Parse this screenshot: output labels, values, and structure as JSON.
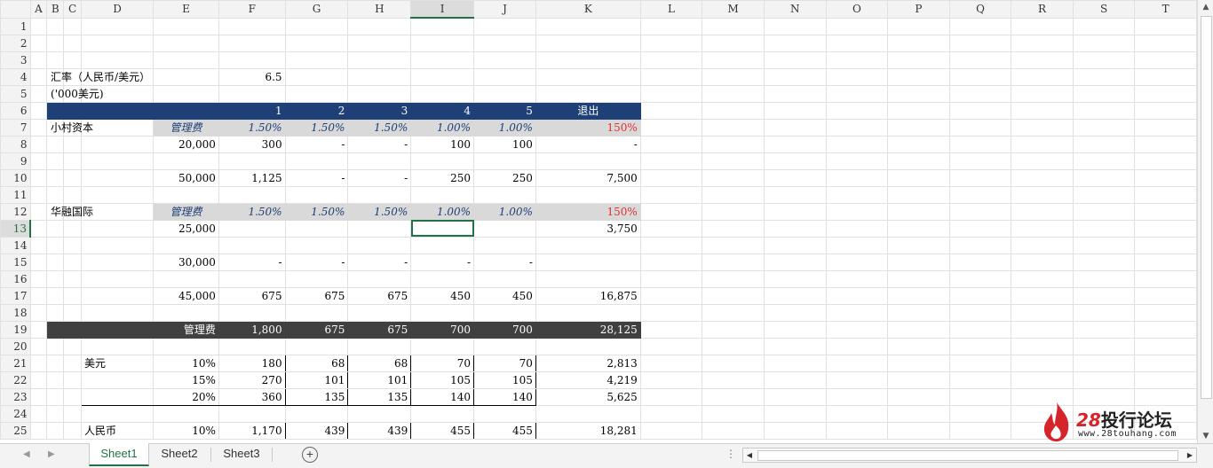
{
  "columns": [
    "A",
    "B",
    "C",
    "D",
    "E",
    "F",
    "G",
    "H",
    "I",
    "J",
    "K",
    "L",
    "M",
    "N",
    "O",
    "P",
    "Q",
    "R",
    "S",
    "T"
  ],
  "selected_column": "I",
  "selected_row": "13",
  "row_numbers": [
    "1",
    "2",
    "3",
    "4",
    "5",
    "6",
    "7",
    "8",
    "9",
    "10",
    "11",
    "12",
    "13",
    "14",
    "15",
    "16",
    "17",
    "18",
    "19",
    "20",
    "21",
    "22",
    "23",
    "24",
    "25"
  ],
  "cells": {
    "D4": "汇率（人民币/美元）",
    "F4": "6.5",
    "D5": "('000美元)",
    "F6": "1",
    "G6": "2",
    "H6": "3",
    "I6": "4",
    "J6": "5",
    "K6": "退出",
    "D7": "小村资本",
    "E7": "管理费",
    "F7": "1.50%",
    "G7": "1.50%",
    "H7": "1.50%",
    "I7": "1.00%",
    "J7": "1.00%",
    "K7": "150%",
    "E8": "20,000",
    "F8": "300",
    "G8": "-",
    "H8": "-",
    "I8": "100",
    "J8": "100",
    "K8": "-",
    "E10": "50,000",
    "F10": "1,125",
    "G10": "-",
    "H10": "-",
    "I10": "250",
    "J10": "250",
    "K10": "7,500",
    "D12": "华融国际",
    "E12": "管理费",
    "F12": "1.50%",
    "G12": "1.50%",
    "H12": "1.50%",
    "I12": "1.00%",
    "J12": "1.00%",
    "K12": "150%",
    "E13": "25,000",
    "K13": "3,750",
    "E15": "30,000",
    "F15": "-",
    "G15": "-",
    "H15": "-",
    "I15": "-",
    "J15": "-",
    "E17": "45,000",
    "F17": "675",
    "G17": "675",
    "H17": "675",
    "I17": "450",
    "J17": "450",
    "K17": "16,875",
    "E19": "管理费",
    "F19": "1,800",
    "G19": "675",
    "H19": "675",
    "I19": "700",
    "J19": "700",
    "K19": "28,125",
    "D21": "美元",
    "E21": "10%",
    "F21": "180",
    "G21": "68",
    "H21": "68",
    "I21": "70",
    "J21": "70",
    "K21": "2,813",
    "E22": "15%",
    "F22": "270",
    "G22": "101",
    "H22": "101",
    "I22": "105",
    "J22": "105",
    "K22": "4,219",
    "E23": "20%",
    "F23": "360",
    "G23": "135",
    "H23": "135",
    "I23": "140",
    "J23": "140",
    "K23": "5,625",
    "D25": "人民币",
    "E25": "10%",
    "F25": "1,170",
    "G25": "439",
    "H25": "439",
    "I25": "455",
    "J25": "455",
    "K25": "18,281"
  },
  "sheet_tabs": [
    "Sheet1",
    "Sheet2",
    "Sheet3"
  ],
  "active_tab": "Sheet1",
  "add_sheet_symbol": "+",
  "watermark": {
    "number": "28",
    "name": "投行论坛",
    "site": "www.28touhang.com"
  },
  "colors": {
    "header_blue": "#1f3f77",
    "label_gray": "#d9d9d9",
    "dark_row": "#404040",
    "accent_green": "#217346",
    "red": "#e03131"
  }
}
